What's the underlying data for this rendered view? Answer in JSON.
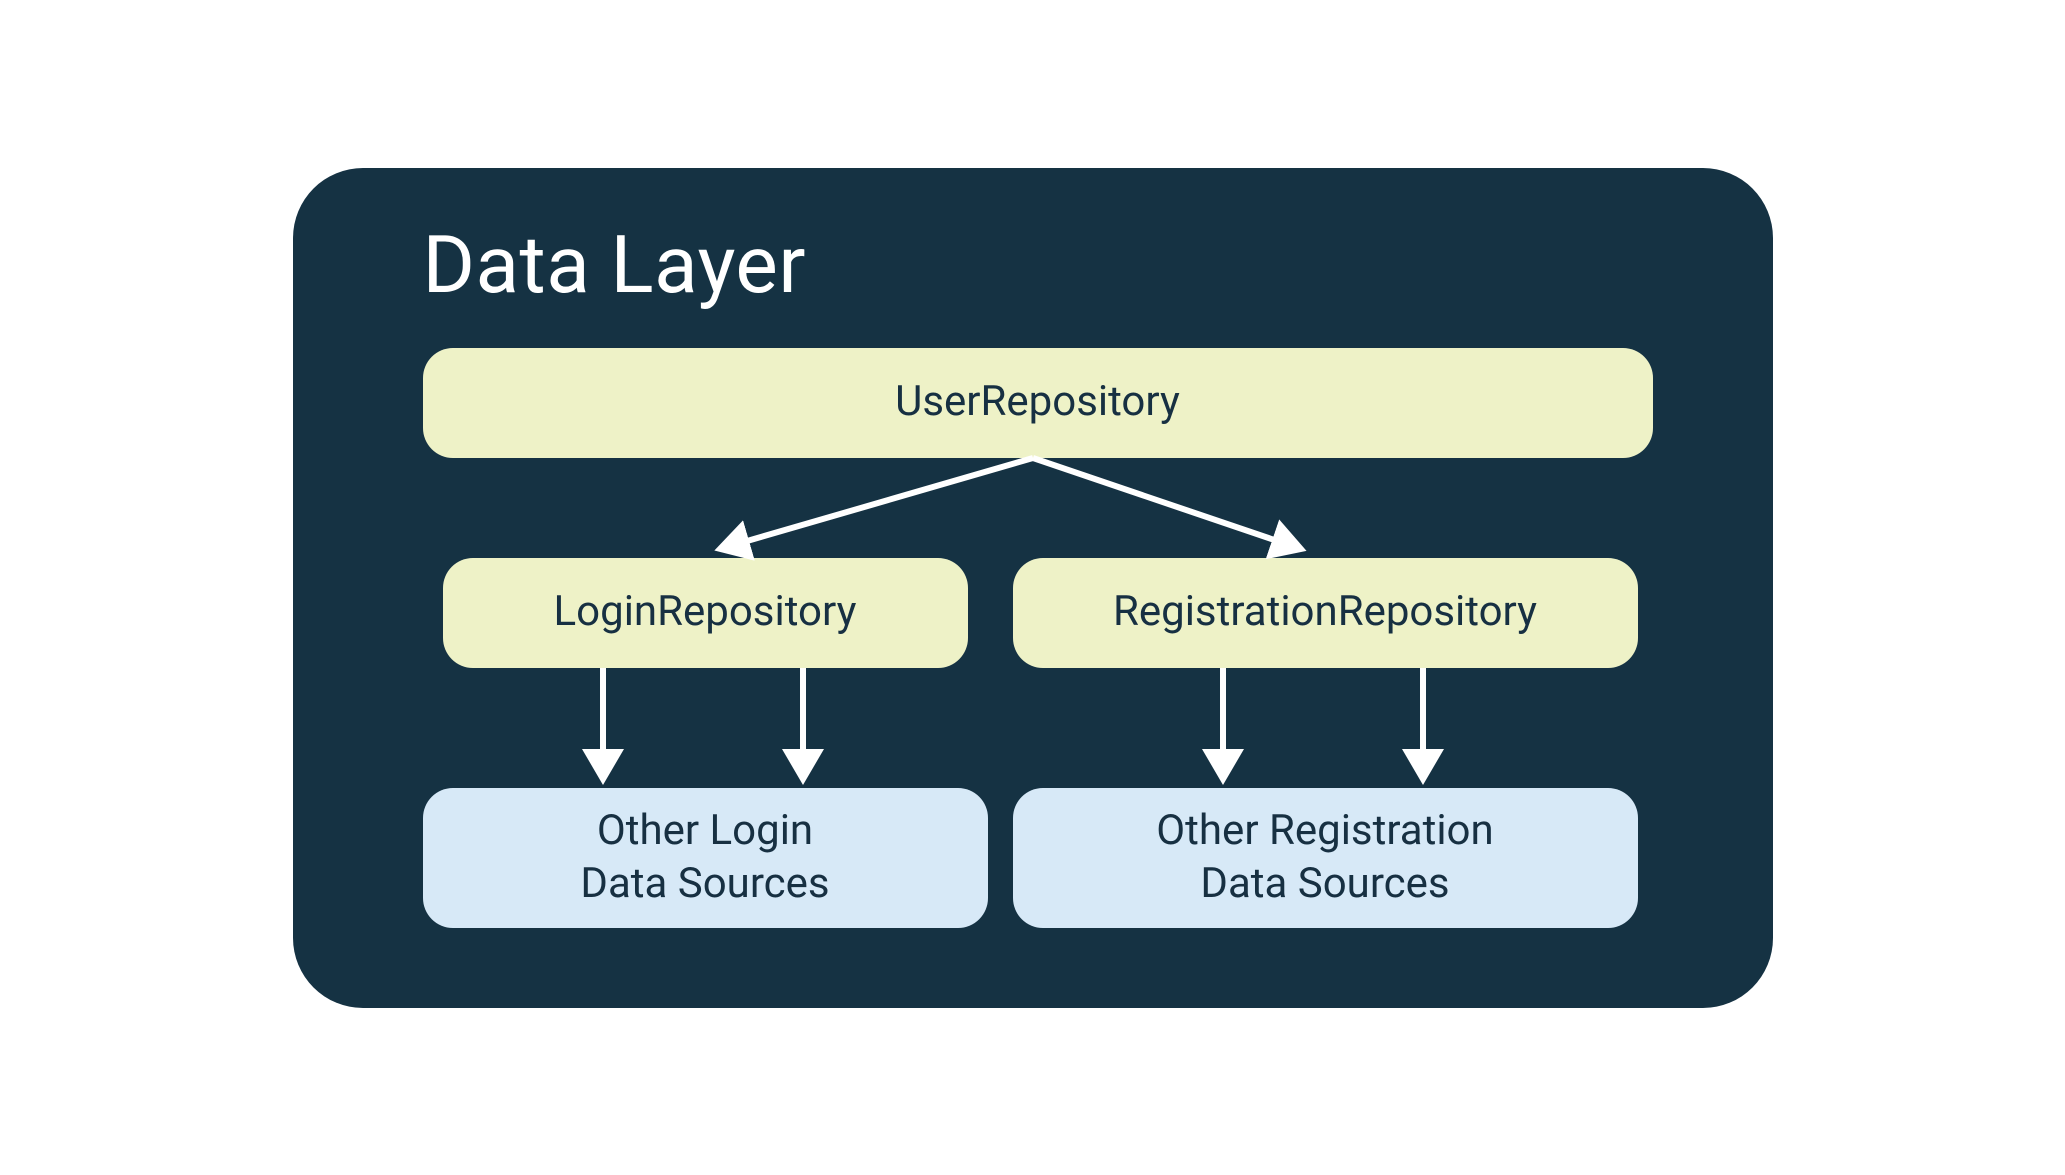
{
  "diagram": {
    "title": "Data Layer",
    "nodes": {
      "user_repo": "UserRepository",
      "login_repo": "LoginRepository",
      "registration_repo": "RegistrationRepository",
      "login_sources": "Other Login\nData Sources",
      "registration_sources": "Other Registration\nData Sources"
    },
    "colors": {
      "background": "#153243",
      "node_green": "#eef2c7",
      "node_blue": "#d7e9f7",
      "arrow": "#ffffff",
      "text_dark": "#173042",
      "text_light": "#ffffff"
    },
    "edges": [
      {
        "from": "user_repo",
        "to": "login_repo"
      },
      {
        "from": "user_repo",
        "to": "registration_repo"
      },
      {
        "from": "login_repo",
        "to": "login_sources"
      },
      {
        "from": "login_repo",
        "to": "login_sources"
      },
      {
        "from": "registration_repo",
        "to": "registration_sources"
      },
      {
        "from": "registration_repo",
        "to": "registration_sources"
      }
    ]
  }
}
